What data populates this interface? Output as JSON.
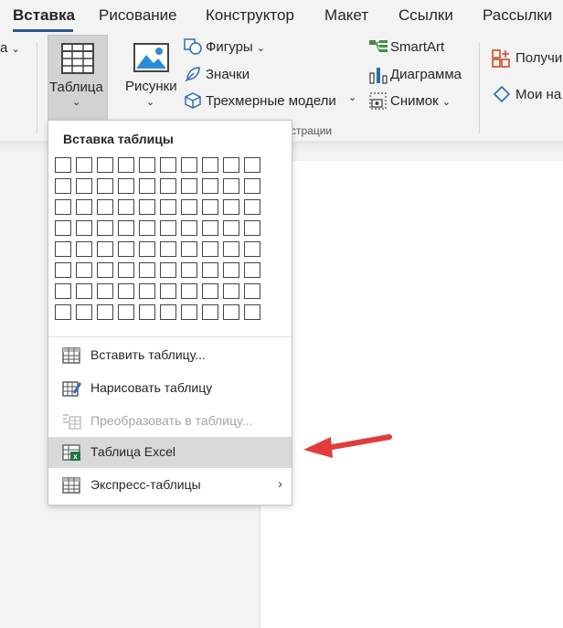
{
  "tabs": [
    "Вставка",
    "Рисование",
    "Конструктор",
    "Макет",
    "Ссылки",
    "Рассылки"
  ],
  "ribbon": {
    "left_partial": "а",
    "table_label": "Таблица",
    "pictures_label": "Рисунки",
    "shapes_label": "Фигуры",
    "icons_label": "Значки",
    "models3d_label": "Трехмерные модели",
    "smartart_label": "SmartArt",
    "chart_label": "Диаграмма",
    "screenshot_label": "Снимок",
    "get_addins_label": "Получи",
    "my_addins_label": "Мои на",
    "group_partial": "страции"
  },
  "dropdown": {
    "title": "Вставка таблицы",
    "grid_rows": 8,
    "grid_cols": 10,
    "items": [
      {
        "label": "Вставить таблицу...",
        "icon": "insert-table-icon",
        "enabled": true
      },
      {
        "label": "Нарисовать таблицу",
        "icon": "draw-table-icon",
        "enabled": true
      },
      {
        "label": "Преобразовать в таблицу...",
        "icon": "convert-table-icon",
        "enabled": false
      },
      {
        "label": "Таблица Excel",
        "icon": "excel-table-icon",
        "enabled": true,
        "highlighted": true
      },
      {
        "label": "Экспресс-таблицы",
        "icon": "quick-tables-icon",
        "enabled": true,
        "submenu": true
      }
    ]
  },
  "colors": {
    "accent": "#2b579a",
    "annotation_arrow": "#e03c3c",
    "excel_green": "#217346"
  }
}
